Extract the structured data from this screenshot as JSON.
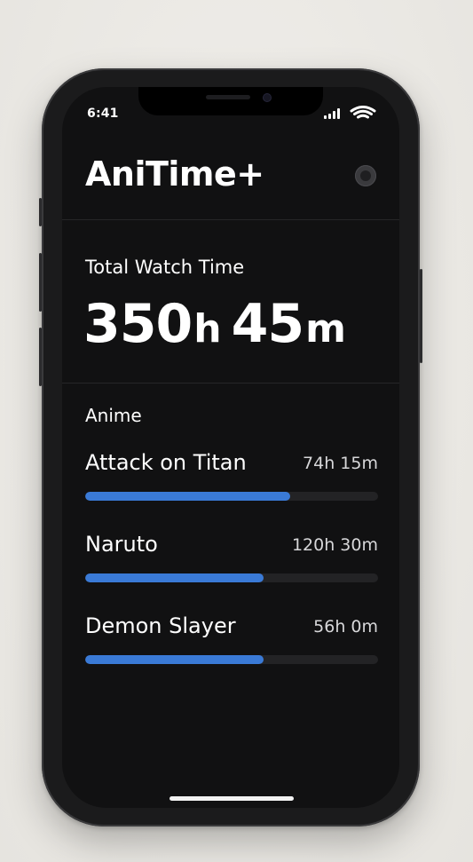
{
  "status_bar": {
    "time": "6:41"
  },
  "header": {
    "app_title": "AniTime+"
  },
  "total": {
    "label": "Total Watch Time",
    "hours": "350",
    "hours_unit": "h",
    "minutes": "45",
    "minutes_unit": "m"
  },
  "anime_section": {
    "label": "Anime",
    "items": [
      {
        "name": "Attack on Titan",
        "time": "74h 15m",
        "progress": 0.7
      },
      {
        "name": "Naruto",
        "time": "120h 30m",
        "progress": 0.61
      },
      {
        "name": "Demon Slayer",
        "time": "56h 0m",
        "progress": 0.61
      }
    ]
  },
  "colors": {
    "accent": "#3a7ad6",
    "background": "#111112",
    "track": "#232325"
  },
  "icons": {
    "profile": "avatar-icon",
    "signal": "cellular-signal-icon",
    "wifi": "wifi-icon"
  }
}
